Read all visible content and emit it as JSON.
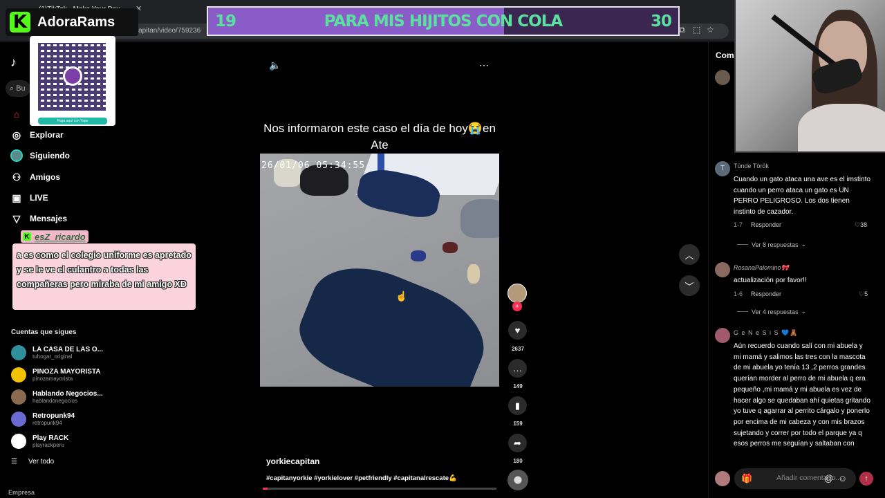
{
  "browser": {
    "tab_title": "(1)TikTok - Make Your Day",
    "url": "...kiecapitan/video/759236"
  },
  "overlay": {
    "brand_letter": "K",
    "brand_name": "AdoraRams",
    "qr_caption": "Paga aquí con Yape",
    "goal": {
      "current": "19",
      "title": "PARA MIS HIJITOS CON COLA",
      "target": "30",
      "progress_fraction": 0.63
    },
    "chat": {
      "badge": "K",
      "username": "esZ_ricardo",
      "message": "a es como el colegio uniforme es apretado y se le ve el culantro a todas las compañeras pero miraba de mi amigo XD"
    }
  },
  "sidebar": {
    "search_placeholder": "Bu",
    "nav": [
      {
        "label": "",
        "icon": "home-icon"
      },
      {
        "label": "Explorar",
        "icon": "compass-icon"
      },
      {
        "label": "Siguiendo",
        "icon": "avatar-icon"
      },
      {
        "label": "Amigos",
        "icon": "friends-icon"
      },
      {
        "label": "LIVE",
        "icon": "live-icon"
      },
      {
        "label": "Mensajes",
        "icon": "send-icon"
      }
    ],
    "following_title": "Cuentas que sigues",
    "accounts": [
      {
        "name": "LA CASA DE LAS O...",
        "handle": "tuhogar_original",
        "color": "#2f8f9d"
      },
      {
        "name": "PINOZA MAYORISTA",
        "handle": "pinozamayorista",
        "color": "#f2c200"
      },
      {
        "name": "Hablando Negocios...",
        "handle": "hablandonegocios",
        "color": "#8a6a50"
      },
      {
        "name": "Retropunk94",
        "handle": "retropunk94",
        "color": "#6a6ad0"
      },
      {
        "name": "Play RACK",
        "handle": "playrackperu",
        "color": "#ffffff"
      }
    ],
    "see_all": "Ver todo",
    "footer": "Empresa"
  },
  "video": {
    "caption": "Nos informaron este caso el día de hoy😭en Ate",
    "timestamp": "26/01/06 05:34:55",
    "username": "yorkiecapitan",
    "hashtags": "#capitanyorkie #yorkielover #petfriendly #capitanalrescate💪",
    "progress_fraction": 0.02,
    "actions": {
      "likes": "2637",
      "comments": "149",
      "saves": "159",
      "shares": "180"
    }
  },
  "comments": {
    "header": "Come",
    "items": [
      {
        "user": "Tünde Török",
        "text": "Cuando un gato ataca una ave es el imstinto cuando un perro ataca un gato es UN PERRO PELIGROSO. Los dos tienen instinto de cazador.",
        "date": "1-7",
        "reply": "Responder",
        "likes": "38",
        "more": "Ver 8 respuestas",
        "avatar_color": "#5a6a78",
        "avatar_letter": "T"
      },
      {
        "user": "RosanaPalomino🎀",
        "text": "actualización por favor!!",
        "date": "1-6",
        "reply": "Responder",
        "likes": "5",
        "more": "Ver 4 respuestas",
        "avatar_color": "#8a6a60",
        "avatar_letter": ""
      },
      {
        "user": "G e N e S i S 💙🧸",
        "text": "Aún recuerdo cuando salí con mi abuela y mi mamá y salimos las tres con la mascota de mi abuela yo tenía 13 ,2 perros grandes querían morder al perro de mi abuela q era pequeño ,mi mamá y mi abuela es vez de hacer algo se quedaban ahí quietas gritando yo tuve q agarrar al perrito cárgalo y ponerlo por encima de mi cabeza y con mis brazos sujetando y correr por todo el parque ya q esos perros me seguían y saltaban con",
        "avatar_color": "#a05a6a",
        "avatar_letter": ""
      }
    ],
    "add_placeholder": "Añadir comentario..."
  },
  "colors": {
    "accent": "#fe2c55",
    "kick_green": "#53fc18",
    "goal_fill": "#8a5cc8",
    "goal_text": "#5ce0a0"
  }
}
